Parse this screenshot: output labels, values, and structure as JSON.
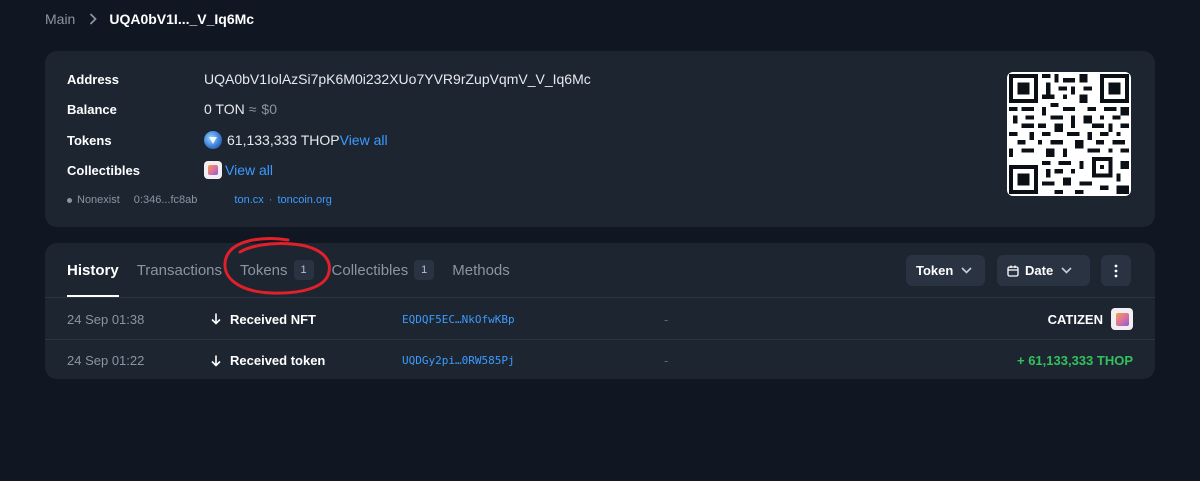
{
  "breadcrumb": {
    "main": "Main",
    "current": "UQA0bV1I..._V_Iq6Mc"
  },
  "info": {
    "address_label": "Address",
    "address_value": "UQA0bV1IolAzSi7pK6M0i232XUo7YVR9rZupVqmV_V_Iq6Mc",
    "balance_label": "Balance",
    "balance_value": "0 TON",
    "balance_approx": "≈",
    "balance_fiat": "$0",
    "tokens_label": "Tokens",
    "tokens_value": "61,133,333 THOP",
    "tokens_view_all": "View all",
    "collectibles_label": "Collectibles",
    "collectibles_view_all": "View all",
    "status": "Nonexist",
    "hash": "0:346...fc8ab",
    "ext_link_1": "ton.cx",
    "ext_sep": "·",
    "ext_link_2": "toncoin.org"
  },
  "tabs": [
    {
      "label": "History",
      "active": true
    },
    {
      "label": "Transactions"
    },
    {
      "label": "Tokens",
      "count": "1"
    },
    {
      "label": "Collectibles",
      "count": "1"
    },
    {
      "label": "Methods"
    }
  ],
  "filters": {
    "token": "Token",
    "date": "Date"
  },
  "transactions": [
    {
      "time": "24 Sep 01:38",
      "action": "Received NFT",
      "address": "EQDQF5EC…NkOfwKBp",
      "comment": "-",
      "amount": "CATIZEN"
    },
    {
      "time": "24 Sep 01:22",
      "action": "Received token",
      "address": "UQDGy2pi…0RW585Pj",
      "comment": "-",
      "amount": "+ 61,133,333 THOP"
    }
  ],
  "colors": {
    "background": "#111722",
    "card": "#1d2531",
    "link": "#3d9bff",
    "positive": "#33c15e",
    "annotation": "#e0202a"
  },
  "icons": [
    "chevron-right-icon",
    "qr-code",
    "thop-token-icon",
    "catizen-nft-icon",
    "chevron-down-icon",
    "calendar-icon",
    "more-vertical-icon",
    "arrow-down-icon"
  ]
}
